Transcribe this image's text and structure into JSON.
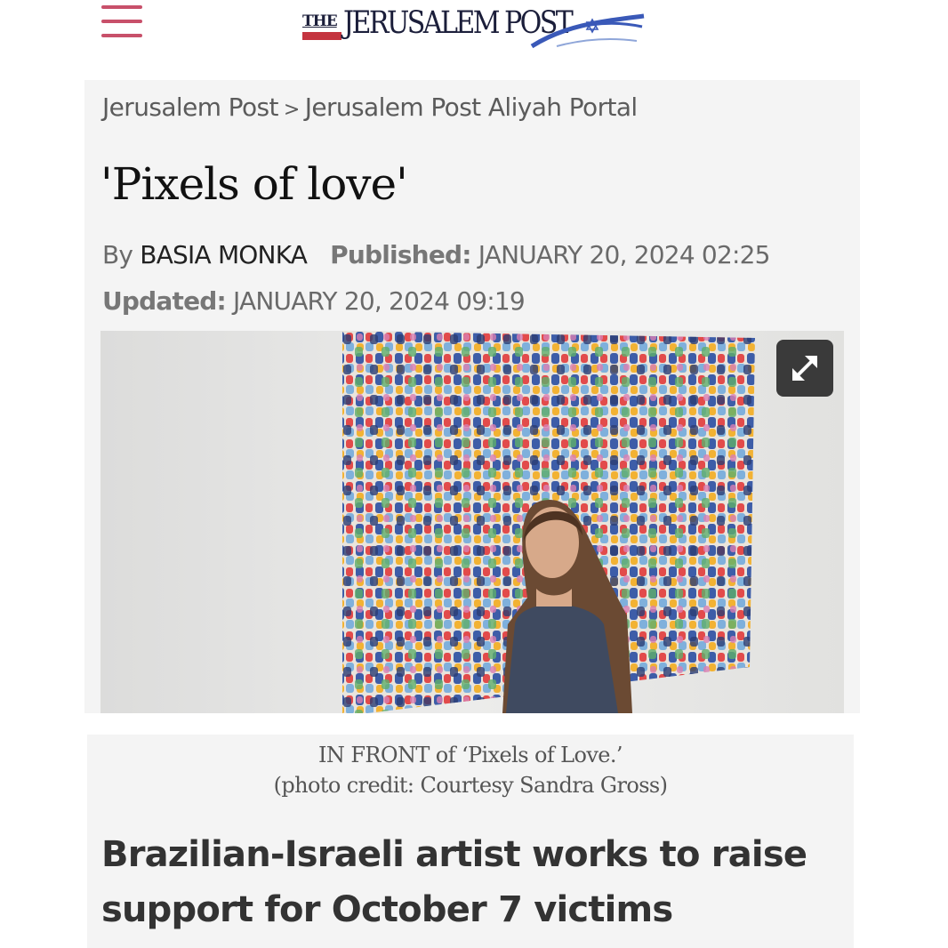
{
  "header": {
    "menu_icon": "hamburger-menu-icon",
    "logo_the": "THE",
    "logo_name": "JERUSALEM POST",
    "logo_colors": {
      "text": "#1b1e3a",
      "red": "#c4343f",
      "blue": "#3a59b8"
    }
  },
  "breadcrumb": {
    "items": [
      "Jerusalem Post",
      "Jerusalem Post Aliyah Portal"
    ],
    "separator": ">"
  },
  "article": {
    "title": "'Pixels of love'",
    "by_label": "By",
    "author": "BASIA MONKA",
    "published_label": "Published:",
    "published": "JANUARY 20, 2024 02:25",
    "updated_label": "Updated:",
    "updated": "JANUARY 20, 2024 09:19",
    "image": {
      "expand_icon": "expand-arrows-icon"
    },
    "caption_line1": "IN FRONT of ‘Pixels of Love.’",
    "caption_line2": "(photo credit: Courtesy Sandra Gross)",
    "subheadline": "Brazilian-Israeli artist works to raise support for October 7 victims"
  },
  "colors": {
    "menu_accent": "#c8506a",
    "card_bg": "#f4f4f4"
  }
}
